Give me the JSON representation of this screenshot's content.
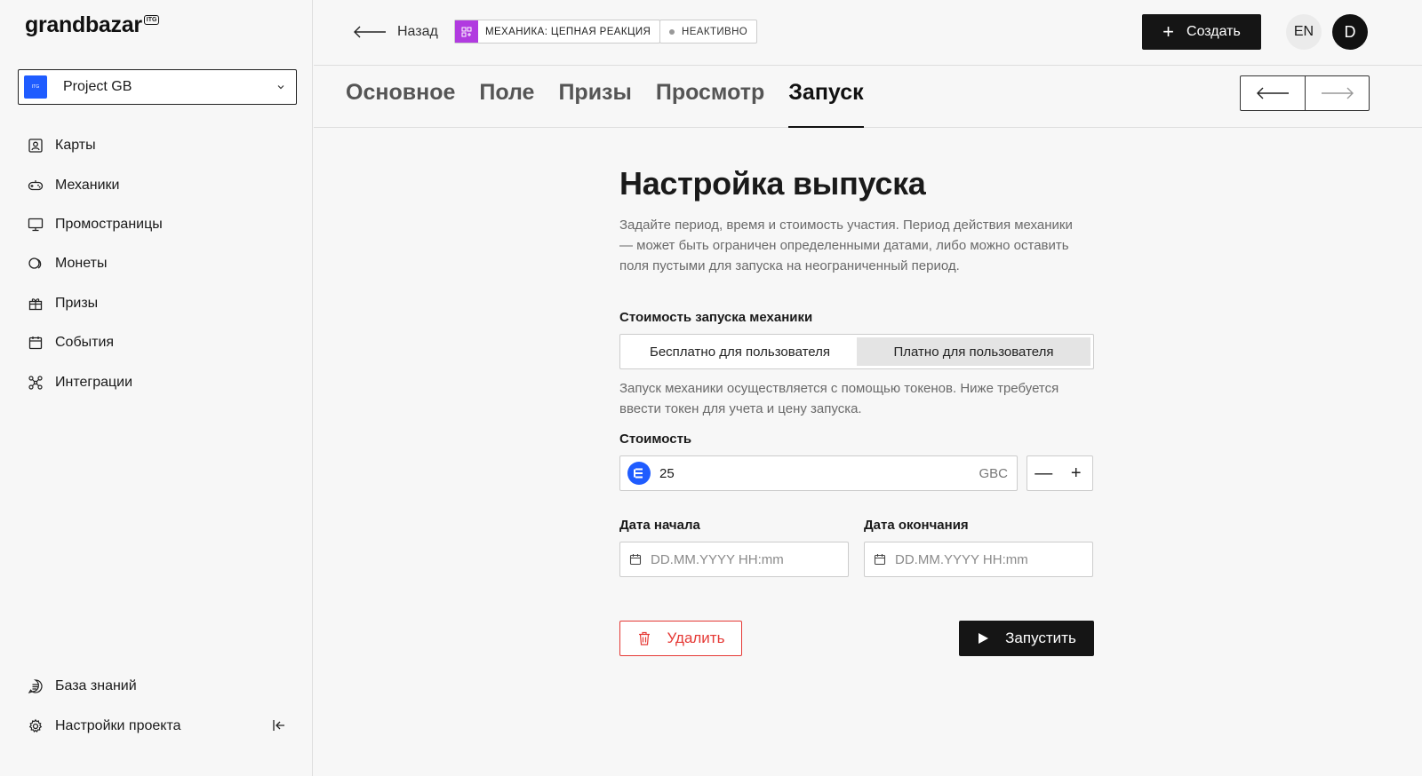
{
  "app": {
    "logo": "grandbazar",
    "logo_badge": "ITG"
  },
  "project": {
    "name": "Project GB",
    "logo_text": "ITG"
  },
  "sidebar": {
    "items": [
      {
        "label": "Карты",
        "icon": "portrait-card-icon"
      },
      {
        "label": "Механики",
        "icon": "gamepad-icon"
      },
      {
        "label": "Промостраницы",
        "icon": "monitor-icon"
      },
      {
        "label": "Монеты",
        "icon": "coins-icon"
      },
      {
        "label": "Призы",
        "icon": "gift-icon"
      },
      {
        "label": "События",
        "icon": "calendar-icon"
      },
      {
        "label": "Интеграции",
        "icon": "nodes-icon"
      }
    ],
    "bottom": [
      {
        "label": "База знаний",
        "icon": "chat-doc-icon"
      },
      {
        "label": "Настройки проекта",
        "icon": "gear-icon"
      }
    ]
  },
  "header": {
    "back_label": "Назад",
    "mechanic_badge": "МЕХАНИКА: ЦЕПНАЯ РЕАКЦИЯ",
    "status_badge": "НЕАКТИВНО",
    "create_label": "Создать",
    "lang": "EN",
    "avatar": "D"
  },
  "tabs": [
    {
      "label": "Основное",
      "active": false
    },
    {
      "label": "Поле",
      "active": false
    },
    {
      "label": "Призы",
      "active": false
    },
    {
      "label": "Просмотр",
      "active": false
    },
    {
      "label": "Запуск",
      "active": true
    }
  ],
  "form": {
    "title": "Настройка выпуска",
    "description": "Задайте период, время и стоимость участия. Период действия механики — может быть ограничен определенными датами, либо можно оставить поля пустыми для запуска на неограниченный период.",
    "cost_mode_label": "Стоимость запуска механики",
    "cost_mode_options": [
      "Бесплатно для пользователя",
      "Платно для пользователя"
    ],
    "cost_mode_selected": "Платно для пользователя",
    "hint": "Запуск механики осуществляется с помощью токенов. Ниже требуется ввести токен для учета и цену запуска.",
    "cost_label": "Стоимость",
    "cost_value": "25",
    "cost_unit": "GBC",
    "stepper_minus": "—",
    "stepper_plus": "+",
    "start_label": "Дата начала",
    "start_placeholder": "DD.MM.YYYY HH:mm",
    "end_label": "Дата окончания",
    "end_placeholder": "DD.MM.YYYY HH:mm",
    "delete_label": "Удалить",
    "launch_label": "Запустить"
  },
  "colors": {
    "accent": "#151515",
    "danger": "#e53935",
    "project": "#1f5cff",
    "mechanic": "#b13be0"
  }
}
